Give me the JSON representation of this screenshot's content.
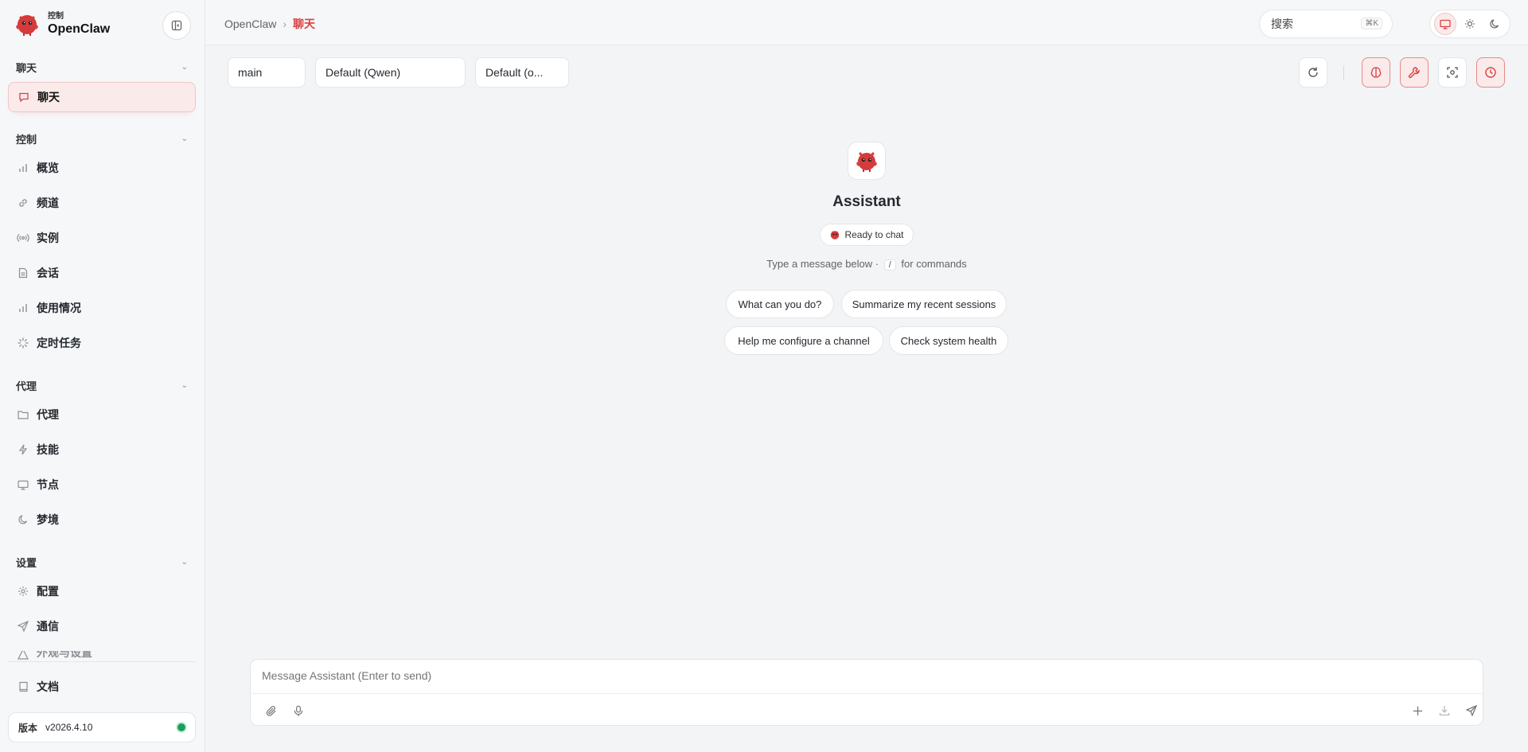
{
  "brand": {
    "sub": "控制",
    "name": "OpenClaw"
  },
  "sidebar": {
    "sections": [
      {
        "title": "聊天",
        "items": [
          {
            "label": "聊天",
            "icon": "message-icon",
            "active": true
          }
        ]
      },
      {
        "title": "控制",
        "items": [
          {
            "label": "概览",
            "icon": "bar-chart-icon"
          },
          {
            "label": "频道",
            "icon": "link-icon"
          },
          {
            "label": "实例",
            "icon": "radio-icon"
          },
          {
            "label": "会话",
            "icon": "document-icon"
          },
          {
            "label": "使用情况",
            "icon": "bar-chart-icon"
          },
          {
            "label": "定时任务",
            "icon": "loader-icon"
          }
        ]
      },
      {
        "title": "代理",
        "items": [
          {
            "label": "代理",
            "icon": "folder-icon"
          },
          {
            "label": "技能",
            "icon": "zap-icon"
          },
          {
            "label": "节点",
            "icon": "monitor-icon"
          },
          {
            "label": "梦境",
            "icon": "moon-icon"
          }
        ]
      },
      {
        "title": "设置",
        "items": [
          {
            "label": "配置",
            "icon": "gear-icon"
          },
          {
            "label": "通信",
            "icon": "send-icon"
          },
          {
            "label": "外观与设置",
            "icon": "palette-icon"
          }
        ]
      }
    ],
    "docs": {
      "label": "文档",
      "icon": "book-icon"
    },
    "version": {
      "label": "版本",
      "value": "v2026.4.10",
      "status_color": "#1aa05b"
    }
  },
  "header": {
    "breadcrumb": {
      "root": "OpenClaw",
      "sep": "›",
      "current": "聊天"
    },
    "search": {
      "placeholder": "搜索",
      "shortcut": "⌘K"
    },
    "theme_modes": [
      "system",
      "light",
      "dark"
    ]
  },
  "session": {
    "selectors": [
      "main",
      "Default (Qwen)",
      "Default (o..."
    ],
    "tools": [
      "refresh-icon",
      "brain-icon",
      "wrench-icon",
      "focus-icon",
      "clock-icon"
    ]
  },
  "welcome": {
    "title": "Assistant",
    "status": "Ready to chat",
    "hint_before": "Type a message below ·",
    "hint_key": "/",
    "hint_after": "for commands",
    "suggestions": [
      "What can you do?",
      "Summarize my recent sessions",
      "Help me configure a channel",
      "Check system health"
    ]
  },
  "composer": {
    "placeholder": "Message Assistant (Enter to send)"
  },
  "colors": {
    "accent": "#d94141",
    "accent_bg": "#fbeaea",
    "bg": "#f3f4f6"
  }
}
